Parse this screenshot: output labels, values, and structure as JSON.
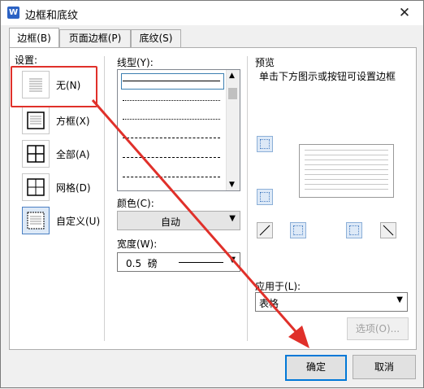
{
  "window": {
    "title": "边框和底纹",
    "icon": "W"
  },
  "tabs": [
    {
      "label": "边框(B)",
      "active": true
    },
    {
      "label": "页面边框(P)",
      "active": false
    },
    {
      "label": "底纹(S)",
      "active": false
    }
  ],
  "settings": {
    "label": "设置:",
    "items": [
      {
        "label": "无(N)",
        "icon": "none-border-icon",
        "selected": true
      },
      {
        "label": "方框(X)",
        "icon": "box-border-icon"
      },
      {
        "label": "全部(A)",
        "icon": "all-borders-icon"
      },
      {
        "label": "网格(D)",
        "icon": "grid-borders-icon"
      },
      {
        "label": "自定义(U)",
        "icon": "custom-border-icon"
      }
    ]
  },
  "line_style": {
    "label": "线型(Y):"
  },
  "color": {
    "label": "颜色(C):",
    "value": "自动"
  },
  "width": {
    "label": "宽度(W):",
    "value": "0.5  磅"
  },
  "preview": {
    "label": "预览",
    "hint": "单击下方图示或按钮可设置边框"
  },
  "apply_to": {
    "label": "应用于(L):",
    "value": "表格"
  },
  "buttons": {
    "options": "选项(O)...",
    "ok": "确定",
    "cancel": "取消"
  },
  "colors": {
    "highlight": "#e0302a",
    "accent": "#0078d7"
  }
}
